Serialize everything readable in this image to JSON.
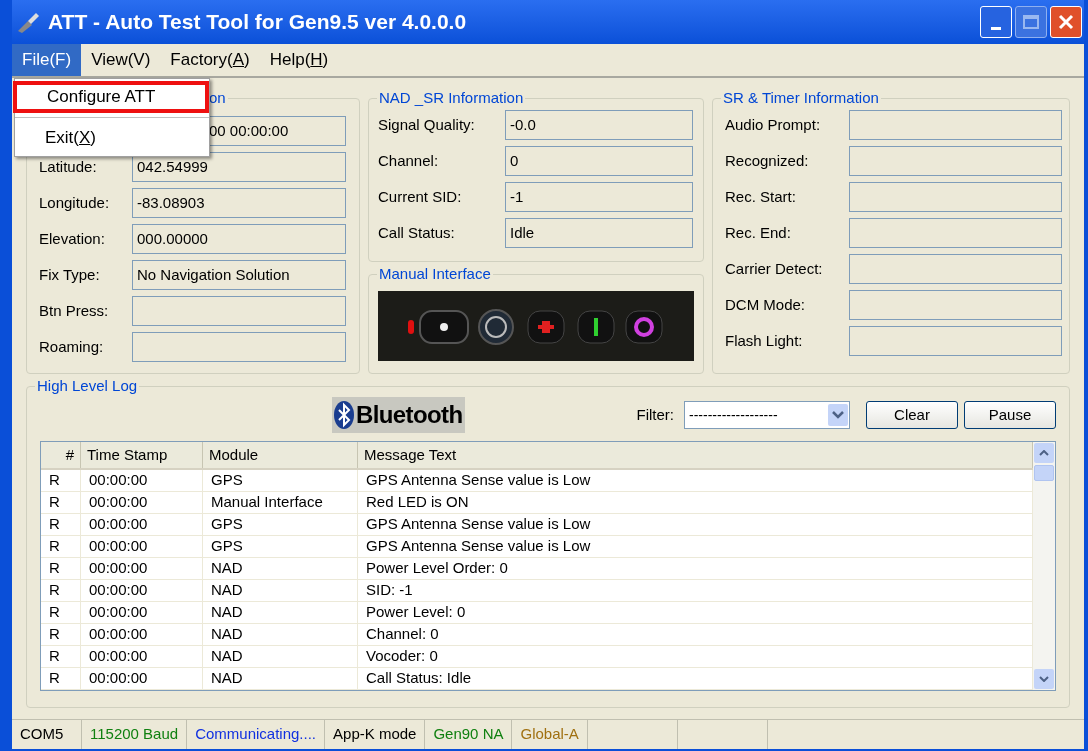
{
  "window": {
    "title": "ATT - Auto Test Tool for Gen9.5 ver 4.0.0.0"
  },
  "menu_bar": [
    {
      "before": "File(",
      "key": "F",
      "after": ")",
      "underlined": false,
      "selected": true
    },
    {
      "before": "View(",
      "key": "V",
      "after": ")",
      "underlined": false,
      "selected": false
    },
    {
      "before": "Factory(",
      "key": "A",
      "after": ")",
      "underlined": true,
      "selected": false
    },
    {
      "before": "Help(",
      "key": "H",
      "after": ")",
      "underlined": true,
      "selected": false
    }
  ],
  "file_menu": [
    {
      "before": "Configure ATT",
      "outlined": true
    },
    {
      "before": "Exit(",
      "key": "X",
      "after": ")",
      "outlined": false
    }
  ],
  "gps_group": {
    "title": "on",
    "fields": [
      {
        "value": "00 00:00:00"
      },
      {
        "label": "Latitude:",
        "value": "042.54999"
      },
      {
        "label": "Longitude:",
        "value": "-83.08903"
      },
      {
        "label": "Elevation:",
        "value": "000.00000"
      },
      {
        "label": "Fix Type:",
        "value": "No Navigation Solution"
      },
      {
        "label": "Btn Press:"
      },
      {
        "label": "Roaming:"
      }
    ]
  },
  "nad_group": {
    "title": "NAD _SR Information",
    "fields": [
      {
        "label": "Signal Quality:",
        "value": "-0.0"
      },
      {
        "label": "Channel:",
        "value": "0"
      },
      {
        "label": "Current SID:",
        "value": "-1"
      },
      {
        "label": "Call Status:",
        "value": "Idle"
      }
    ]
  },
  "manual_interface": {
    "title": "Manual Interface"
  },
  "sr_group": {
    "title": "SR & Timer Information",
    "fields": [
      {
        "label": "Audio Prompt:"
      },
      {
        "label": "Recognized:"
      },
      {
        "label": "Rec. Start:"
      },
      {
        "label": "Rec. End:"
      },
      {
        "label": "Carrier Detect:"
      },
      {
        "label": "DCM Mode:"
      },
      {
        "label": "Flash Light:"
      }
    ]
  },
  "log": {
    "title": "High Level Log",
    "logo": "Bluetooth",
    "filter_label": "Filter:",
    "filter_value": "-------------------",
    "buttons": [
      "Clear",
      "Pause"
    ],
    "columns": [
      "#",
      "Time Stamp",
      "Module",
      "Message Text"
    ],
    "rows": [
      [
        "R",
        "00:00:00",
        "GPS",
        "GPS Antenna Sense value is Low"
      ],
      [
        "R",
        "00:00:00",
        "Manual Interface",
        "Red LED is ON"
      ],
      [
        "R",
        "00:00:00",
        "GPS",
        "GPS Antenna Sense value is Low"
      ],
      [
        "R",
        "00:00:00",
        "GPS",
        "GPS Antenna Sense value is Low"
      ],
      [
        "R",
        "00:00:00",
        "NAD",
        "Power Level Order: 0"
      ],
      [
        "R",
        "00:00:00",
        "NAD",
        "SID: -1"
      ],
      [
        "R",
        "00:00:00",
        "NAD",
        "Power Level: 0"
      ],
      [
        "R",
        "00:00:00",
        "NAD",
        "Channel: 0"
      ],
      [
        "R",
        "00:00:00",
        "NAD",
        "Vocoder: 0"
      ],
      [
        "R",
        "00:00:00",
        "NAD",
        "Call Status: Idle"
      ]
    ]
  },
  "status_bar": [
    {
      "text": "COM5",
      "color": "#000000"
    },
    {
      "text": "115200 Baud",
      "color": "#108010"
    },
    {
      "text": "Communicating....",
      "color": "#1030e0"
    },
    {
      "text": "App-K mode",
      "color": "#000000"
    },
    {
      "text": "Gen90 NA",
      "color": "#108010"
    },
    {
      "text": "Global-A",
      "color": "#a07010"
    }
  ]
}
